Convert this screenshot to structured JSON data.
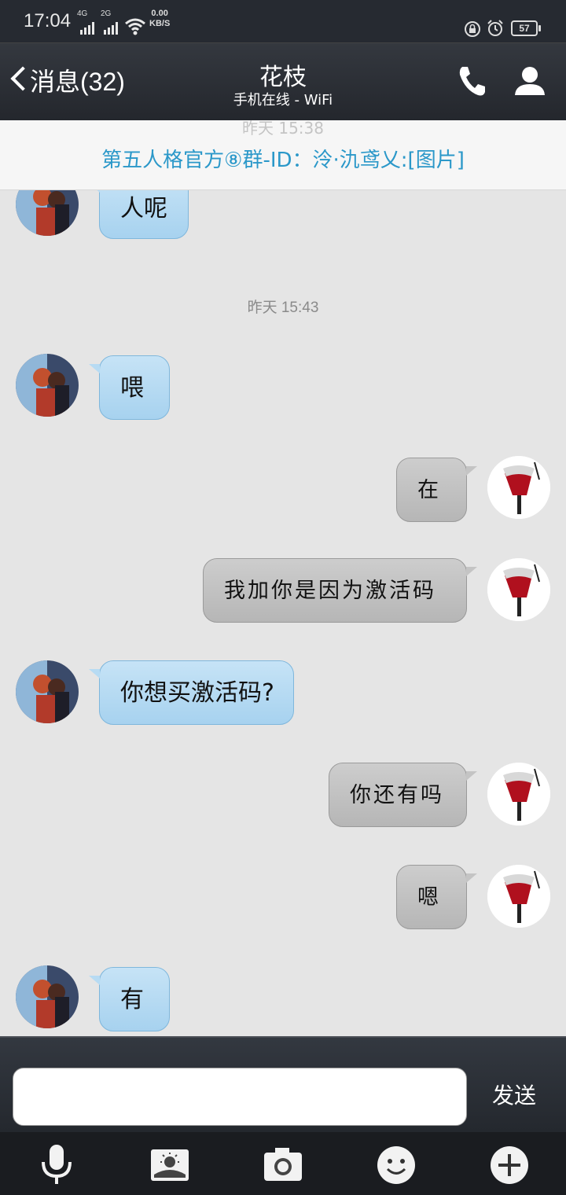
{
  "status_bar": {
    "time": "17:04",
    "net1": "4G",
    "net2": "2G",
    "speed_value": "0.00",
    "speed_unit": "KB/S",
    "battery": "57"
  },
  "header": {
    "back_label": "消息(32)",
    "title": "花枝",
    "subtitle": "手机在线 - WiFi"
  },
  "notice": {
    "ghost_time": "昨天 15:38",
    "text": "第五人格官方⑧群-ID：泠·氿鸢乂:[图片]"
  },
  "chat": {
    "timestamp": "昨天 15:43",
    "messages": [
      {
        "side": "in",
        "text": "人呢"
      },
      {
        "side": "in",
        "text": "喂"
      },
      {
        "side": "out",
        "text": "在"
      },
      {
        "side": "out",
        "text": "我加你是因为激活码"
      },
      {
        "side": "in",
        "text": "你想买激活码?"
      },
      {
        "side": "out",
        "text": "你还有吗"
      },
      {
        "side": "out",
        "text": "嗯"
      },
      {
        "side": "in",
        "text": "有"
      }
    ]
  },
  "input": {
    "placeholder": "",
    "send_label": "发送"
  },
  "toolbar": {
    "icons": [
      "microphone-icon",
      "image-icon",
      "camera-icon",
      "emoji-icon",
      "plus-icon"
    ]
  },
  "colors": {
    "bar_dark": "#262a31",
    "incoming_bubble": "#b7dbf3",
    "outgoing_bubble": "#c4c4c4",
    "notice_text": "#2b98c9",
    "chat_bg": "#e5e5e5"
  }
}
